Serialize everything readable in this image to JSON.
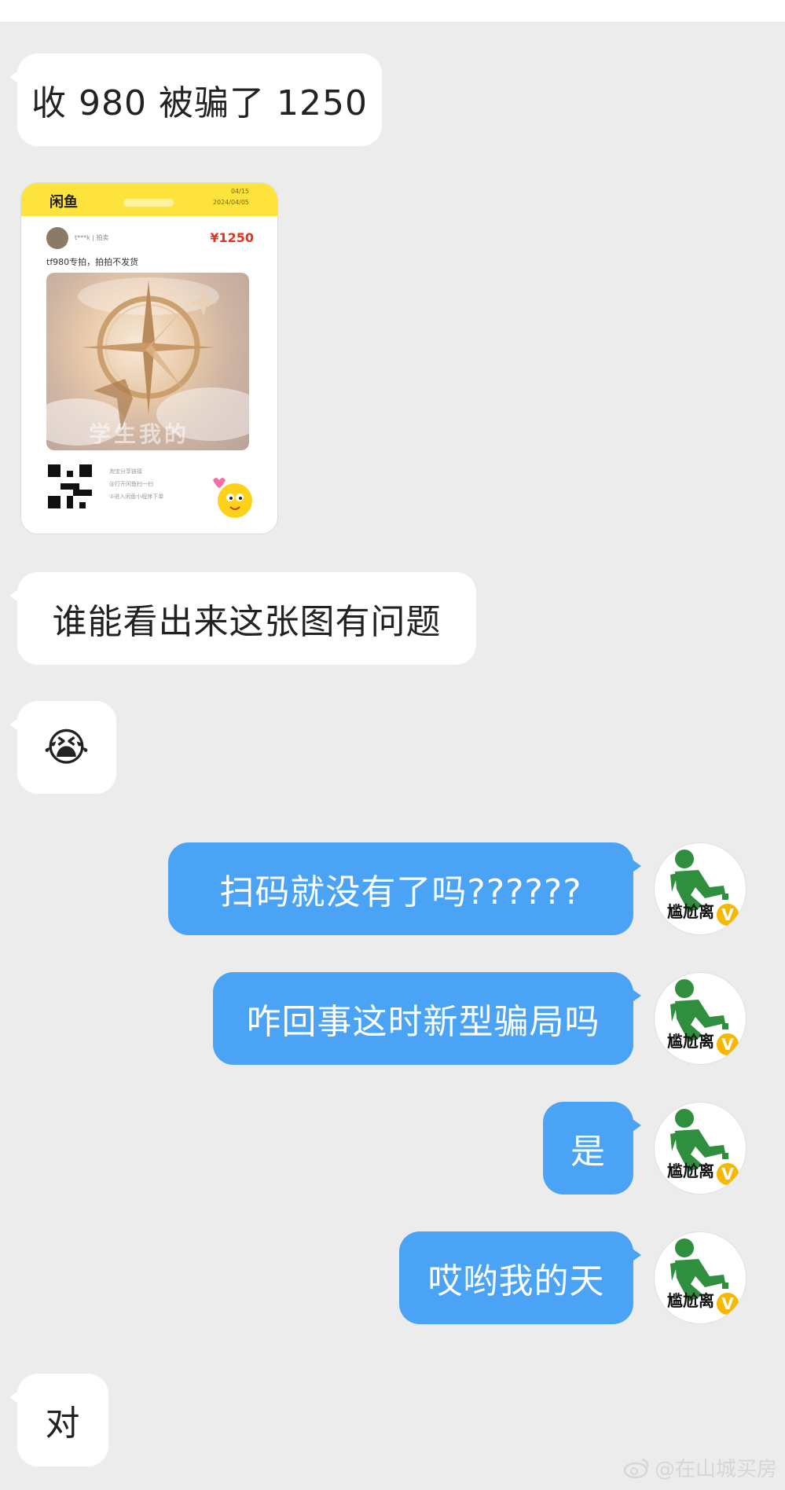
{
  "messages": {
    "m1": "收 980 被骗了 1250",
    "m3": "谁能看出来这张图有问题",
    "m4_emoji": "😭",
    "m5": "扫码就没有了吗??????",
    "m6": "咋回事这时新型骗局吗",
    "m7": "是",
    "m8": "哎哟我的天",
    "m9": "对"
  },
  "card": {
    "brand": "闲鱼",
    "header_line1": "04/15",
    "header_line2": "2024/04/05",
    "user": "t***k | 拍卖",
    "price": "¥1250",
    "description": "tf980专拍，拍拍不发货",
    "art_text": "学生我的",
    "qr_line1": "淘宝分享链接",
    "qr_line2": "@打开闲鱼扫一扫",
    "qr_line3": "②进入闲鱼小程序下单"
  },
  "avatar": {
    "caption": "尴尬离",
    "badge": "V"
  },
  "watermark": {
    "text": "@在山城买房"
  },
  "colors": {
    "outgoing_bubble": "#4aa3f5",
    "incoming_bubble": "#ffffff",
    "background": "#ececec",
    "avatar_figure": "#2f8f3e",
    "badge": "#f6b800",
    "card_header": "#ffe33d",
    "price": "#e8331a"
  }
}
